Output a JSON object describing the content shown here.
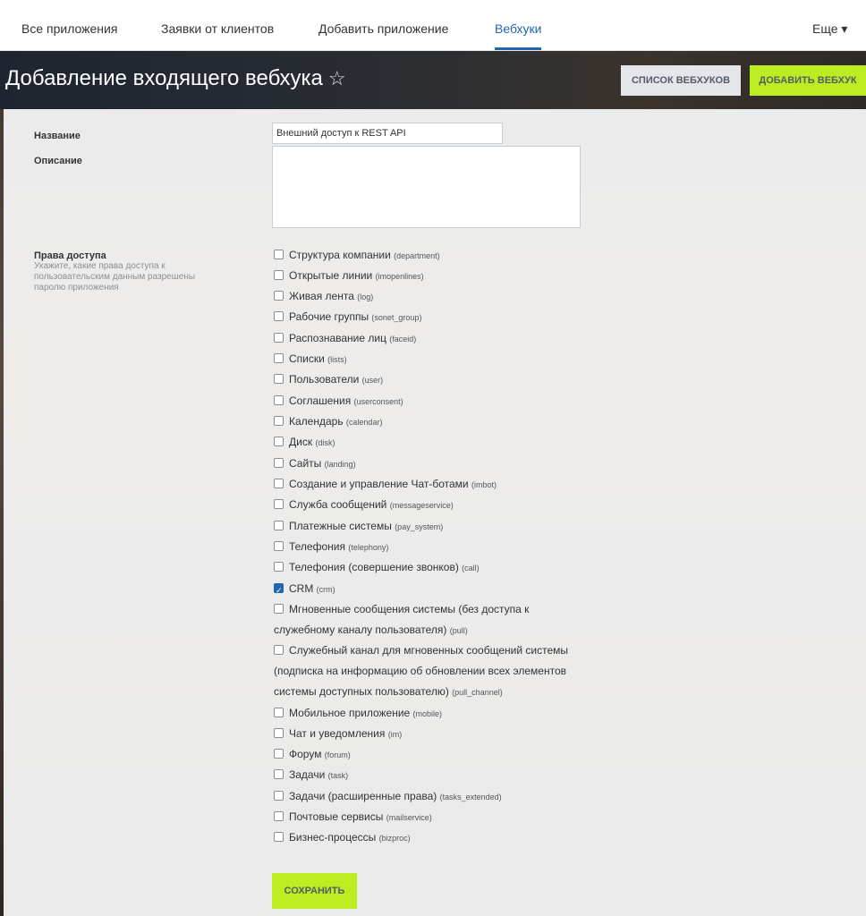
{
  "nav": {
    "tabs": [
      "Все приложения",
      "Заявки от клиентов",
      "Добавить приложение",
      "Вебхуки"
    ],
    "active_tab": "Вебхуки",
    "more": "Еще ▾"
  },
  "header": {
    "title": "Добавление входящего вебхука",
    "star": "☆",
    "list_button": "СПИСОК ВЕБХУКОВ",
    "add_button": "ДОБАВИТЬ ВЕБХУК"
  },
  "form": {
    "name_label": "Название",
    "name_value": "Внешний доступ к REST API",
    "description_label": "Описание",
    "rights_label": "Права доступа",
    "rights_hint": "Укажите, какие права доступа к пользовательским данным разрешены паролю приложения",
    "permissions": [
      {
        "label": "Структура компании",
        "code": "(department)",
        "checked": false
      },
      {
        "label": "Открытые линии",
        "code": "(imopenlines)",
        "checked": false
      },
      {
        "label": "Живая лента",
        "code": "(log)",
        "checked": false
      },
      {
        "label": "Рабочие группы",
        "code": "(sonet_group)",
        "checked": false
      },
      {
        "label": "Распознавание лиц",
        "code": "(faceid)",
        "checked": false
      },
      {
        "label": "Списки",
        "code": "(lists)",
        "checked": false
      },
      {
        "label": "Пользователи",
        "code": "(user)",
        "checked": false
      },
      {
        "label": "Соглашения",
        "code": "(userconsent)",
        "checked": false
      },
      {
        "label": "Календарь",
        "code": "(calendar)",
        "checked": false
      },
      {
        "label": "Диск",
        "code": "(disk)",
        "checked": false
      },
      {
        "label": "Сайты",
        "code": "(landing)",
        "checked": false
      },
      {
        "label": "Создание и управление Чат-ботами",
        "code": "(imbot)",
        "checked": false
      },
      {
        "label": "Служба сообщений",
        "code": "(messageservice)",
        "checked": false
      },
      {
        "label": "Платежные системы",
        "code": "(pay_system)",
        "checked": false
      },
      {
        "label": "Телефония",
        "code": "(telephony)",
        "checked": false
      },
      {
        "label": "Телефония (совершение звонков)",
        "code": "(call)",
        "checked": false
      },
      {
        "label": "CRM",
        "code": "(crm)",
        "checked": true
      },
      {
        "label": "Мгновенные сообщения системы (без доступа к служебному каналу пользователя)",
        "code": "(pull)",
        "checked": false
      },
      {
        "label": "Служебный канал для мгновенных сообщений системы (подписка на информацию об обновлении всех элементов системы доступных пользователю)",
        "code": "(pull_channel)",
        "checked": false
      },
      {
        "label": "Мобильное приложение",
        "code": "(mobile)",
        "checked": false
      },
      {
        "label": "Чат и уведомления",
        "code": "(im)",
        "checked": false
      },
      {
        "label": "Форум",
        "code": "(forum)",
        "checked": false
      },
      {
        "label": "Задачи",
        "code": "(task)",
        "checked": false
      },
      {
        "label": "Задачи (расширенные права)",
        "code": "(tasks_extended)",
        "checked": false
      },
      {
        "label": "Почтовые сервисы",
        "code": "(mailservice)",
        "checked": false
      },
      {
        "label": "Бизнес-процессы",
        "code": "(bizproc)",
        "checked": false
      }
    ],
    "save_button": "СОХРАНИТЬ"
  }
}
